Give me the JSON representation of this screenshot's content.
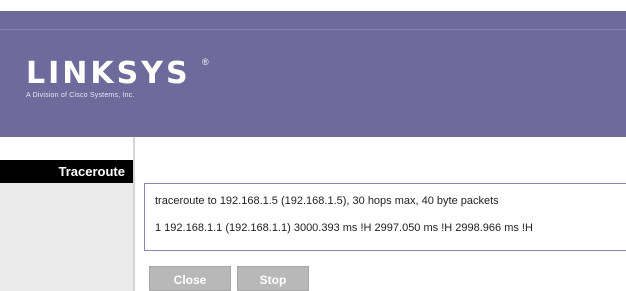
{
  "brand": {
    "name": "LINKSYS",
    "registered_mark": "®",
    "tagline": "A Division of Cisco Systems, Inc."
  },
  "section": {
    "title": "Traceroute"
  },
  "output": {
    "lines": [
      "traceroute to 192.168.1.5 (192.168.1.5), 30 hops max, 40 byte packets",
      "1 192.168.1.1 (192.168.1.1) 3000.393 ms !H 2997.050 ms !H 2998.966 ms !H"
    ]
  },
  "buttons": {
    "close_label": "Close",
    "stop_label": "Stop"
  },
  "colors": {
    "header": "#6e6a9c",
    "tab": "#000000",
    "box_border": "#8a85b6",
    "button": "#b8b8b8"
  }
}
